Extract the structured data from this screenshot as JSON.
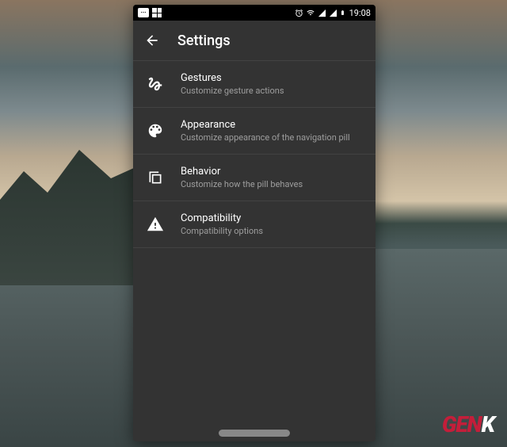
{
  "statusBar": {
    "time": "19:08",
    "badgeText": "⋯"
  },
  "header": {
    "title": "Settings"
  },
  "settings": {
    "items": [
      {
        "title": "Gestures",
        "subtitle": "Customize gesture actions"
      },
      {
        "title": "Appearance",
        "subtitle": "Customize appearance of the navigation pill"
      },
      {
        "title": "Behavior",
        "subtitle": "Customize how the pill behaves"
      },
      {
        "title": "Compatibility",
        "subtitle": "Compatibility options"
      }
    ]
  },
  "watermark": {
    "text": "GENK"
  }
}
